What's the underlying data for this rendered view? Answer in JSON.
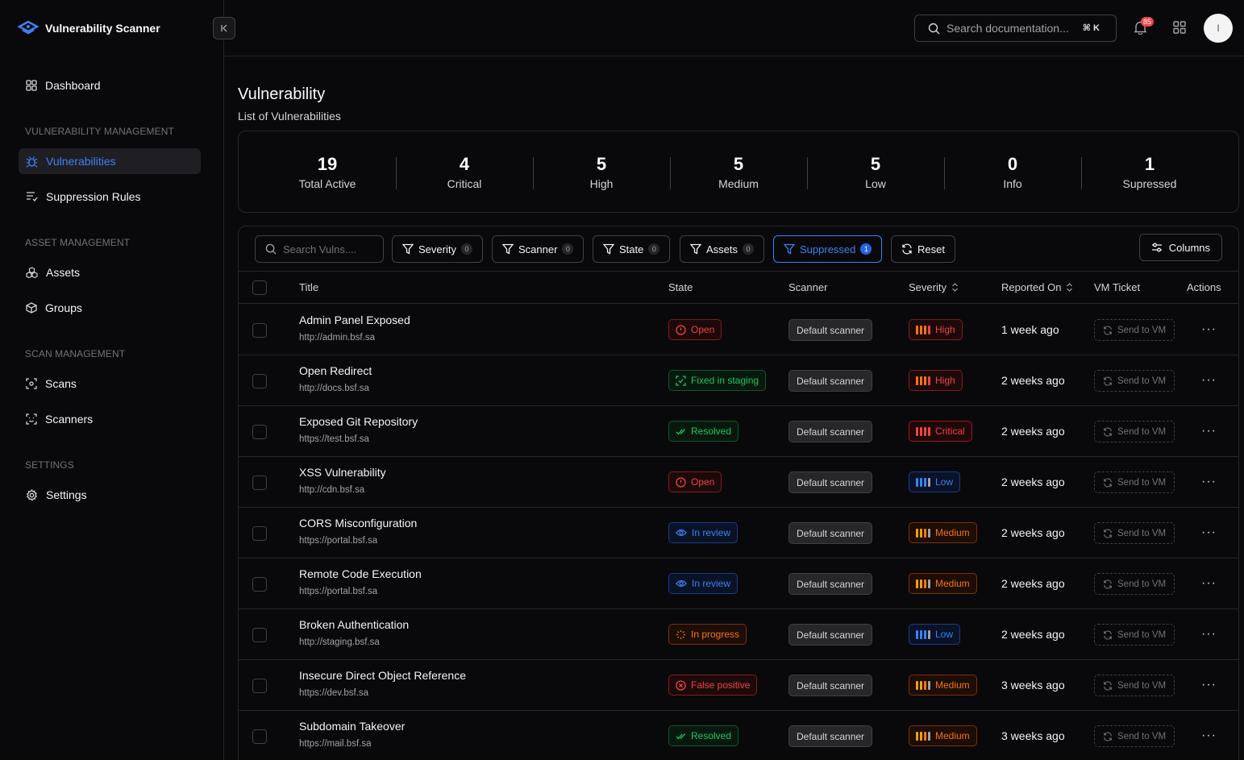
{
  "brand": {
    "name": "Vulnerability Scanner",
    "accent": "#3b82f6"
  },
  "sidebar": {
    "dashboard": "Dashboard",
    "sections": [
      {
        "title": "VULNERABILITY MANAGEMENT",
        "items": [
          "Vulnerabilities",
          "Suppression Rules"
        ]
      },
      {
        "title": "ASSET MANAGEMENT",
        "items": [
          "Assets",
          "Groups"
        ]
      },
      {
        "title": "SCAN MANAGEMENT",
        "items": [
          "Scans",
          "Scanners"
        ]
      },
      {
        "title": "SETTINGS",
        "items": [
          "Settings"
        ]
      }
    ],
    "active": "Vulnerabilities"
  },
  "topbar": {
    "search_placeholder": "Search documentation...",
    "shortcut": "⌘ K",
    "notifications": "85",
    "avatar_initial": "I"
  },
  "page": {
    "title": "Vulnerability",
    "subtitle": "List of Vulnerabilities"
  },
  "stats": [
    {
      "value": "19",
      "label": "Total Active"
    },
    {
      "value": "4",
      "label": "Critical"
    },
    {
      "value": "5",
      "label": "High"
    },
    {
      "value": "5",
      "label": "Medium"
    },
    {
      "value": "5",
      "label": "Low"
    },
    {
      "value": "0",
      "label": "Info"
    },
    {
      "value": "1",
      "label": "Supressed"
    }
  ],
  "toolbar": {
    "search_placeholder": "Search Vulns....",
    "filters": [
      {
        "label": "Severity",
        "count": "0"
      },
      {
        "label": "Scanner",
        "count": "0"
      },
      {
        "label": "State",
        "count": "0"
      },
      {
        "label": "Assets",
        "count": "0"
      },
      {
        "label": "Suppressed",
        "count": "1"
      }
    ],
    "reset": "Reset",
    "columns": "Columns"
  },
  "columns": [
    "Title",
    "State",
    "Scanner",
    "Severity",
    "Reported On",
    "VM Ticket",
    "Actions"
  ],
  "rows": [
    {
      "title": "Admin Panel Exposed",
      "url": "http://admin.bsf.sa",
      "state": "Open",
      "state_kind": "open",
      "scanner": "Default scanner",
      "severity": "High",
      "sev_kind": "high",
      "reported": "1 week ago",
      "vm": "Send to VM"
    },
    {
      "title": "Open Redirect",
      "url": "http://docs.bsf.sa",
      "state": "Fixed in staging",
      "state_kind": "fixed",
      "scanner": "Default scanner",
      "severity": "High",
      "sev_kind": "high",
      "reported": "2 weeks ago",
      "vm": "Send to VM"
    },
    {
      "title": "Exposed Git Repository",
      "url": "https://test.bsf.sa",
      "state": "Resolved",
      "state_kind": "resolved",
      "scanner": "Default scanner",
      "severity": "Critical",
      "sev_kind": "critical",
      "reported": "2 weeks ago",
      "vm": "Send to VM"
    },
    {
      "title": "XSS Vulnerability",
      "url": "http://cdn.bsf.sa",
      "state": "Open",
      "state_kind": "open",
      "scanner": "Default scanner",
      "severity": "Low",
      "sev_kind": "low",
      "reported": "2 weeks ago",
      "vm": "Send to VM"
    },
    {
      "title": "CORS Misconfiguration",
      "url": "https://portal.bsf.sa",
      "state": "In review",
      "state_kind": "review",
      "scanner": "Default scanner",
      "severity": "Medium",
      "sev_kind": "medium",
      "reported": "2 weeks ago",
      "vm": "Send to VM"
    },
    {
      "title": "Remote Code Execution",
      "url": "https://portal.bsf.sa",
      "state": "In review",
      "state_kind": "review",
      "scanner": "Default scanner",
      "severity": "Medium",
      "sev_kind": "medium",
      "reported": "2 weeks ago",
      "vm": "Send to VM"
    },
    {
      "title": "Broken Authentication",
      "url": "http://staging.bsf.sa",
      "state": "In progress",
      "state_kind": "progress",
      "scanner": "Default scanner",
      "severity": "Low",
      "sev_kind": "low",
      "reported": "2 weeks ago",
      "vm": "Send to VM"
    },
    {
      "title": "Insecure Direct Object Reference",
      "url": "https://dev.bsf.sa",
      "state": "False positive",
      "state_kind": "fp",
      "scanner": "Default scanner",
      "severity": "Medium",
      "sev_kind": "medium",
      "reported": "3 weeks ago",
      "vm": "Send to VM"
    },
    {
      "title": "Subdomain Takeover",
      "url": "https://mail.bsf.sa",
      "state": "Resolved",
      "state_kind": "resolved",
      "scanner": "Default scanner",
      "severity": "Medium",
      "sev_kind": "medium",
      "reported": "3 weeks ago",
      "vm": "Send to VM"
    }
  ]
}
